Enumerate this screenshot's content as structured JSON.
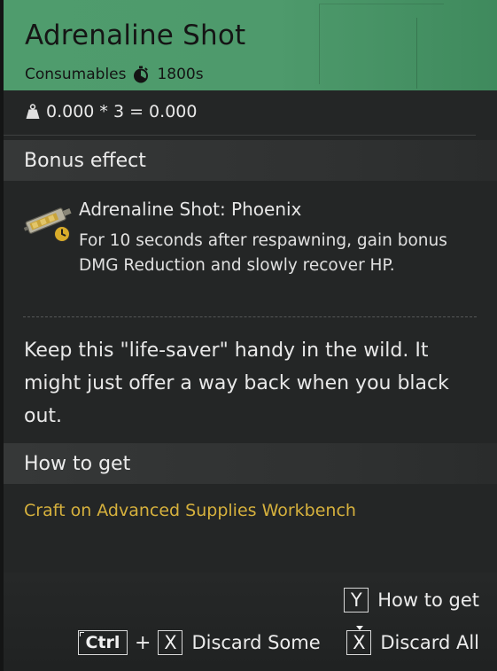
{
  "item": {
    "title": "Adrenaline Shot",
    "category": "Consumables",
    "duration": "1800s",
    "weight_formula": "0.000 * 3 = 0.000"
  },
  "bonus": {
    "heading": "Bonus effect",
    "effect_title": "Adrenaline Shot: Phoenix",
    "effect_description": "For 10 seconds after respawning, gain bonus DMG Reduction and slowly recover HP."
  },
  "flavor_text": "Keep this \"life-saver\" handy in the wild. It might just offer a way back when you black out.",
  "how_to_get": {
    "heading": "How to get",
    "source": "Craft on Advanced Supplies Workbench"
  },
  "controls": {
    "how_to_get": {
      "key": "Y",
      "label": "How to get"
    },
    "discard_some": {
      "modifier": "Ctrl",
      "plus": "+",
      "key": "X",
      "label": "Discard Some"
    },
    "discard_all": {
      "key": "X",
      "label": "Discard All"
    }
  },
  "colors": {
    "header_green": "#4f9c6d",
    "link_gold": "#d6b13d",
    "panel_bg": "#242626"
  },
  "icons": {
    "timer": "stopwatch-icon",
    "weight": "weight-icon",
    "item": "syringe-icon"
  }
}
